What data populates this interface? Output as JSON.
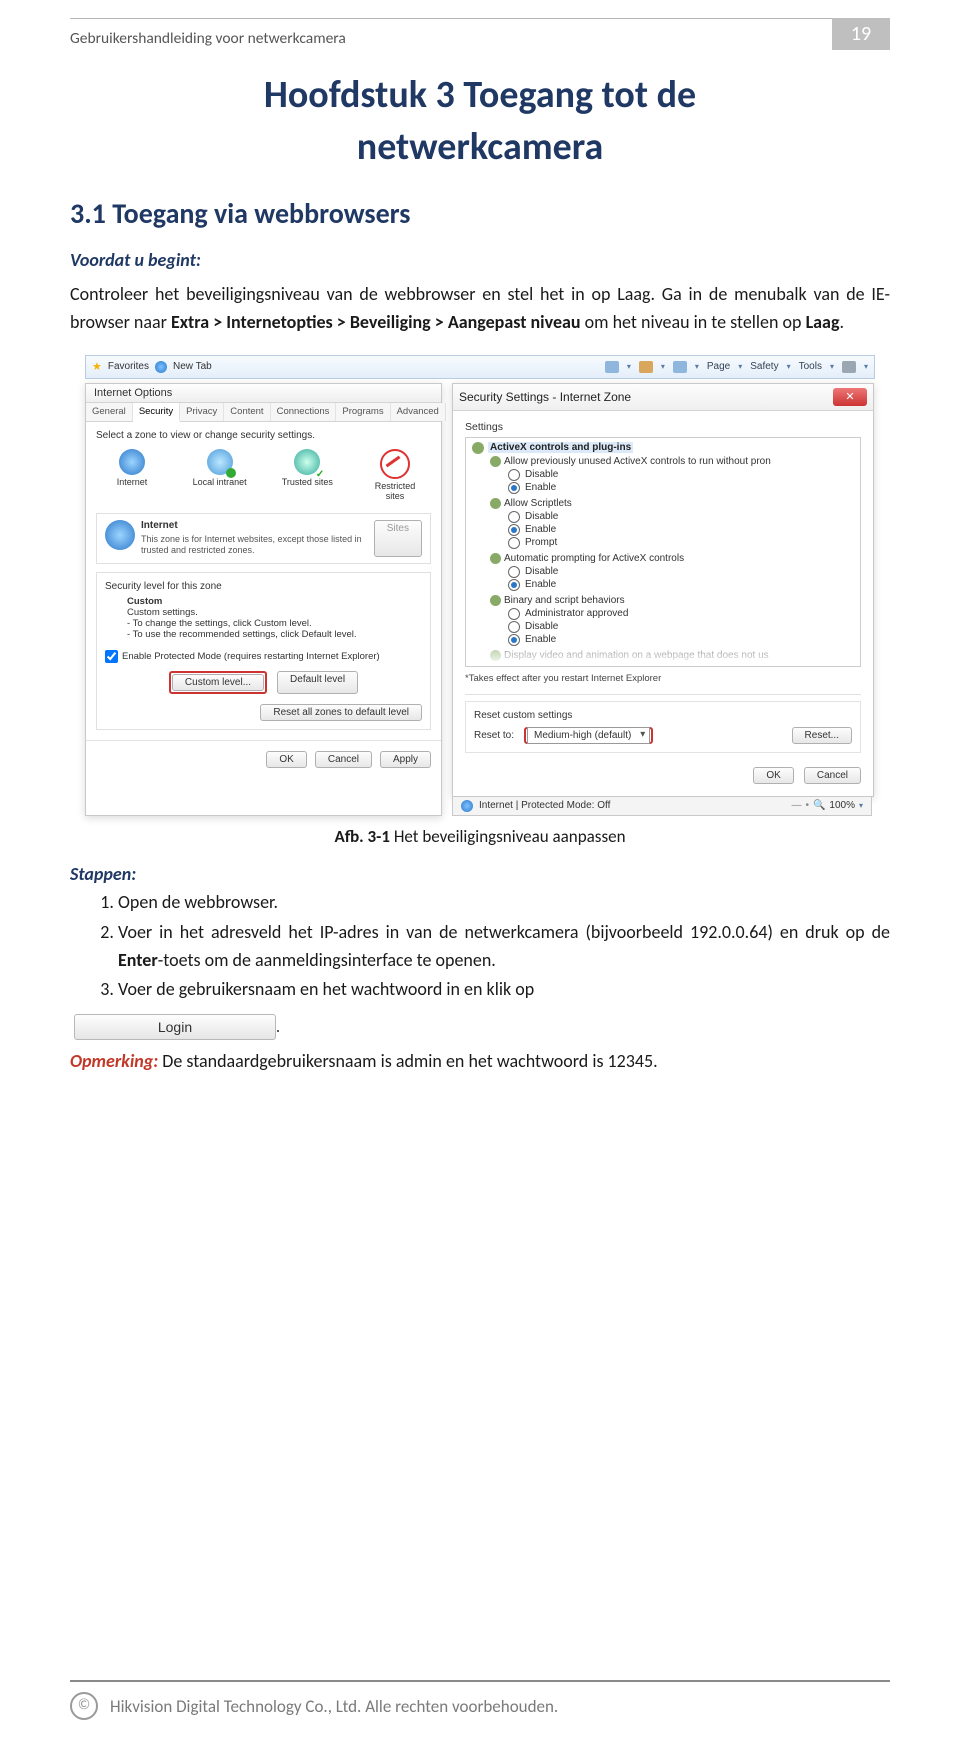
{
  "header": {
    "manual_title": "Gebruikershandleiding voor netwerkcamera",
    "page_number": "19"
  },
  "chapter": {
    "line1": "Hoofdstuk 3   Toegang tot de",
    "line2": "netwerkcamera"
  },
  "section_title": "3.1  Toegang via webbrowsers",
  "before_begin_label": "Voordat u begint:",
  "intro_p1": "Controleer het beveiligingsniveau van de webbrowser en stel het in op Laag. Ga in de menubalk van de IE-browser naar",
  "intro_path": "Extra > Internetopties > Beveiliging > Aangepast niveau",
  "intro_p2": "om het niveau in te stellen op",
  "intro_level": "Laag",
  "screenshot": {
    "favorites_label": "Favorites",
    "new_tab": "New Tab",
    "toolbar": {
      "page": "Page",
      "safety": "Safety",
      "tools": "Tools"
    },
    "inetopt": {
      "title": "Internet Options",
      "tabs": [
        "General",
        "Security",
        "Privacy",
        "Content",
        "Connections",
        "Programs",
        "Advanced"
      ],
      "zone_instruction": "Select a zone to view or change security settings.",
      "zones": {
        "internet": "Internet",
        "local": "Local intranet",
        "trusted": "Trusted sites",
        "restricted": "Restricted sites"
      },
      "internet_head": "Internet",
      "internet_desc": "This zone is for Internet websites, except those listed in trusted and restricted zones.",
      "sites_btn": "Sites",
      "sec_level_label": "Security level for this zone",
      "custom_head": "Custom",
      "custom_l1": "Custom settings.",
      "custom_l2": "- To change the settings, click Custom level.",
      "custom_l3": "- To use the recommended settings, click Default level.",
      "protected_mode": "Enable Protected Mode (requires restarting Internet Explorer)",
      "custom_level_btn": "Custom level...",
      "default_level_btn": "Default level",
      "reset_all_btn": "Reset all zones to default level",
      "ok": "OK",
      "cancel": "Cancel",
      "apply": "Apply"
    },
    "secset": {
      "title": "Security Settings - Internet Zone",
      "settings_label": "Settings",
      "root": "ActiveX controls and plug-ins",
      "item1": {
        "label": "Allow previously unused ActiveX controls to run without pron",
        "opts": [
          "Disable",
          "Enable"
        ],
        "sel": 1
      },
      "item2": {
        "label": "Allow Scriptlets",
        "opts": [
          "Disable",
          "Enable",
          "Prompt"
        ],
        "sel": 1
      },
      "item3": {
        "label": "Automatic prompting for ActiveX controls",
        "opts": [
          "Disable",
          "Enable"
        ],
        "sel": 1
      },
      "item4": {
        "label": "Binary and script behaviors",
        "opts": [
          "Administrator approved",
          "Disable",
          "Enable"
        ],
        "sel": 2
      },
      "item5_partial": "Display video and animation on a webpage that does not us",
      "note": "*Takes effect after you restart Internet Explorer",
      "reset_head": "Reset custom settings",
      "reset_to_label": "Reset to:",
      "reset_value": "Medium-high (default)",
      "reset_btn": "Reset...",
      "ok": "OK",
      "cancel": "Cancel"
    },
    "browser_footer": {
      "globe_label": "Internet | Protected Mode: Off",
      "zoom": "100%"
    }
  },
  "caption": {
    "prefix": "Afb. 3-1",
    "text": "Het beveiligingsniveau aanpassen"
  },
  "steps_label": "Stappen:",
  "step1": "Open de webbrowser.",
  "step2a": "Voer in het adresveld het IP-adres in van de netwerkcamera (bijvoorbeeld 192.0.0.64) en druk op de ",
  "step2b": "Enter",
  "step2c": "-toets om de aanmeldingsinterface te openen.",
  "step3": "Voer de gebruikersnaam en het wachtwoord in en klik op",
  "login_button": "Login",
  "period": ".",
  "opmerking_label": "Opmerking:",
  "opmerking_text": " De standaardgebruikersnaam is admin en het wachtwoord is 12345.",
  "footer": "Hikvision Digital Technology Co., Ltd. Alle rechten voorbehouden."
}
